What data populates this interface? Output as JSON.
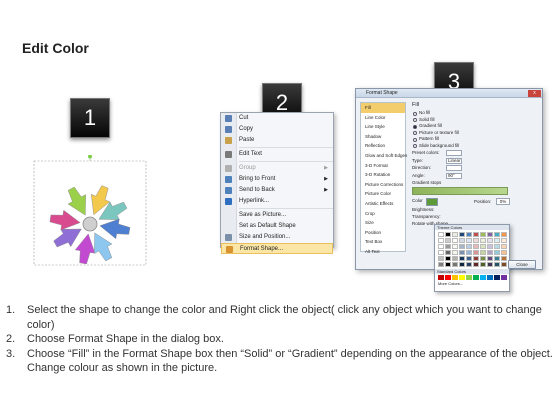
{
  "page": {
    "title": "Edit Color"
  },
  "badges": [
    "1",
    "2",
    "3"
  ],
  "context_menu": {
    "items": [
      {
        "label": "Cut",
        "icon": "scissors-icon",
        "disabled": false,
        "submenu": false
      },
      {
        "label": "Copy",
        "icon": "copy-icon",
        "disabled": false,
        "submenu": false
      },
      {
        "label": "Paste",
        "icon": "paste-icon",
        "disabled": false,
        "submenu": false
      },
      {
        "separator": true
      },
      {
        "label": "Edit Text",
        "icon": "text-icon",
        "disabled": false,
        "submenu": false
      },
      {
        "separator": true
      },
      {
        "label": "Group",
        "icon": "group-icon",
        "disabled": true,
        "submenu": true
      },
      {
        "label": "Bring to Front",
        "icon": "bring-front-icon",
        "disabled": false,
        "submenu": true
      },
      {
        "label": "Send to Back",
        "icon": "send-back-icon",
        "disabled": false,
        "submenu": true
      },
      {
        "label": "Hyperlink...",
        "icon": "hyperlink-icon",
        "disabled": false,
        "submenu": false
      },
      {
        "separator": true
      },
      {
        "label": "Save as Picture...",
        "icon": "",
        "disabled": false,
        "submenu": false
      },
      {
        "label": "Set as Default Shape",
        "icon": "",
        "disabled": false,
        "submenu": false
      },
      {
        "label": "Size and Position...",
        "icon": "size-icon",
        "disabled": false,
        "submenu": false
      },
      {
        "label": "Format Shape...",
        "icon": "format-shape-icon",
        "disabled": false,
        "submenu": false,
        "highlight": true
      }
    ]
  },
  "dialog": {
    "title": "Format Shape",
    "close_glyph": "x",
    "nav": [
      "Fill",
      "Line Color",
      "Line Style",
      "Shadow",
      "Reflection",
      "Glow and Soft Edges",
      "3-D Format",
      "3-D Rotation",
      "Picture Corrections",
      "Picture Color",
      "Artistic Effects",
      "Crop",
      "Size",
      "Position",
      "Text Box",
      "Alt Text"
    ],
    "selected_nav": "Fill",
    "fill_heading": "Fill",
    "fill_options": [
      {
        "label": "No fill",
        "selected": false
      },
      {
        "label": "Solid fill",
        "selected": false
      },
      {
        "label": "Gradient fill",
        "selected": true
      },
      {
        "label": "Picture or texture fill",
        "selected": false
      },
      {
        "label": "Pattern fill",
        "selected": false
      },
      {
        "label": "Slide background fill",
        "selected": false
      }
    ],
    "fields": [
      {
        "label": "Preset colors:",
        "value": ""
      },
      {
        "label": "Type:",
        "value": "Linear"
      },
      {
        "label": "Direction:",
        "value": ""
      },
      {
        "label": "Angle:",
        "value": "90°"
      }
    ],
    "gradient_stops_label": "Gradient stops",
    "color_label": "Color",
    "position_label": "Position:",
    "position_value": "0%",
    "side_labels": [
      "Brightness:",
      "Transparency:",
      "Rotate with shape"
    ],
    "close_button": "Close"
  },
  "color_picker": {
    "theme_header": "Theme Colors",
    "standard_header": "Standard Colors",
    "more_colors": "More Colors...",
    "theme_colors": [
      "#ffffff",
      "#000000",
      "#eeece1",
      "#1f497d",
      "#4f81bd",
      "#c0504d",
      "#9bbb59",
      "#8064a2",
      "#4bacc6",
      "#f79646"
    ],
    "standard_colors": [
      "#c00000",
      "#ff0000",
      "#ffc000",
      "#ffff00",
      "#92d050",
      "#00b050",
      "#00b0f0",
      "#0070c0",
      "#002060",
      "#7030a0"
    ]
  },
  "arrows_colors": [
    "#f2c94c",
    "#9bd04a",
    "#7cc6c0",
    "#4e7fd0",
    "#8f6fd6",
    "#d84c8f",
    "#c24ad0",
    "#8dc7f0"
  ],
  "instructions": [
    {
      "num": "1.",
      "text": "Select the shape to change the color and Right click the object( click any object which you want to change color)"
    },
    {
      "num": "2.",
      "text": "Choose Format Shape in the dialog box."
    },
    {
      "num": "3.",
      "text": "Choose “Fill” in the Format Shape box then “Solid” or “Gradient” depending on the appearance of the object. Change colour as shown in the picture."
    }
  ]
}
